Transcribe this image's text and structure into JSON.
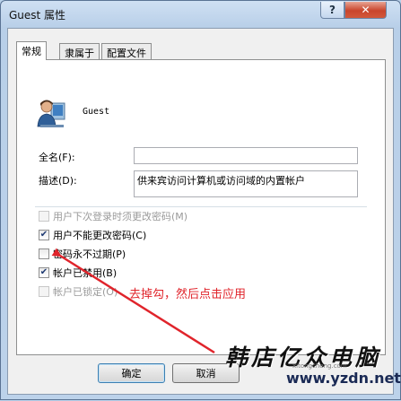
{
  "window": {
    "title": "Guest 属性",
    "help_label": "?",
    "close_label": "✕"
  },
  "tabs": [
    {
      "label": "常规",
      "active": true
    },
    {
      "label": "隶属于",
      "active": false
    },
    {
      "label": "配置文件",
      "active": false
    }
  ],
  "user": {
    "name": "Guest",
    "icon": "user-icon"
  },
  "fields": {
    "fullname_label": "全名(F):",
    "fullname_value": "",
    "description_label": "描述(D):",
    "description_value": "供来宾访问计算机或访问域的内置帐户"
  },
  "options": [
    {
      "label": "用户下次登录时须更改密码(M)",
      "checked": false,
      "enabled": false
    },
    {
      "label": "用户不能更改密码(C)",
      "checked": true,
      "enabled": true
    },
    {
      "label": "密码永不过期(P)",
      "checked": false,
      "enabled": true
    },
    {
      "label": "帐户已禁用(B)",
      "checked": true,
      "enabled": true
    },
    {
      "label": "帐户已锁定(O)",
      "checked": false,
      "enabled": false
    }
  ],
  "buttons": {
    "ok_label": "确定",
    "cancel_label": "取消"
  },
  "annotation": {
    "text": "去掉勾，然后点击应用",
    "color": "#e0242b"
  },
  "watermark": {
    "brand": "韩店亿众电脑",
    "url": "www.yzdn.net",
    "sub": "xitongcheng.com"
  }
}
